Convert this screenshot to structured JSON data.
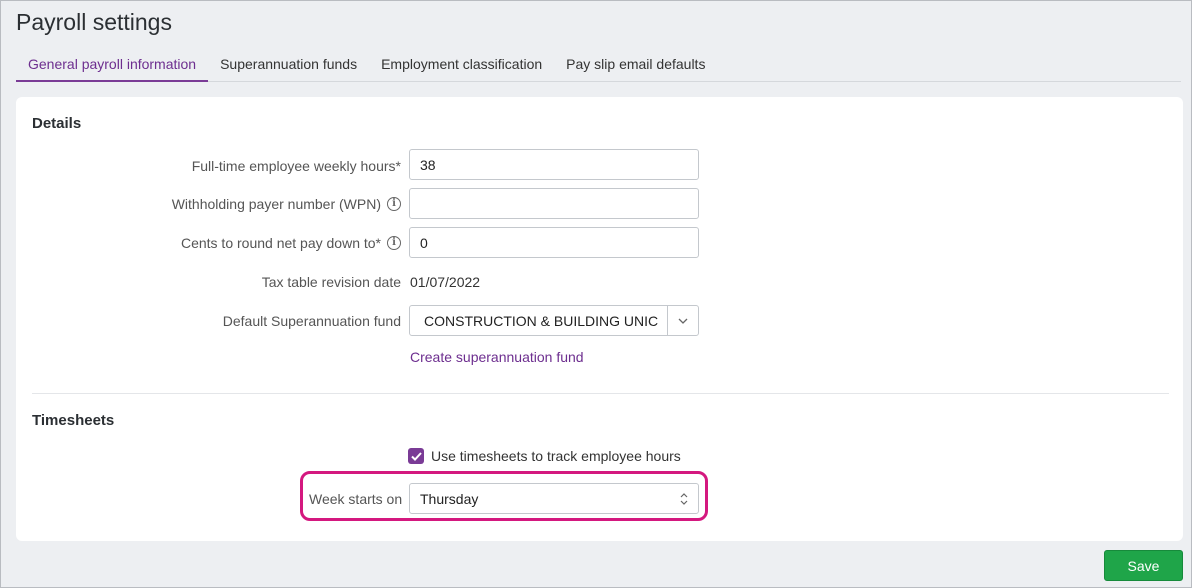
{
  "page": {
    "title": "Payroll settings"
  },
  "tabs": [
    {
      "label": "General payroll information",
      "active": true
    },
    {
      "label": "Superannuation funds",
      "active": false
    },
    {
      "label": "Employment classification",
      "active": false
    },
    {
      "label": "Pay slip email defaults",
      "active": false
    }
  ],
  "details": {
    "heading": "Details",
    "weekly_hours": {
      "label": "Full-time employee weekly hours*",
      "value": "38"
    },
    "wpn": {
      "label": "Withholding payer number (WPN)",
      "value": "",
      "info_icon": "info-icon"
    },
    "rounding": {
      "label": "Cents to round net pay down to*",
      "value": "0",
      "info_icon": "info-icon"
    },
    "tax_table": {
      "label": "Tax table revision date",
      "value": "01/07/2022"
    },
    "super_fund": {
      "label": "Default Superannuation fund",
      "value": "CONSTRUCTION & BUILDING UNIC"
    },
    "create_link": "Create superannuation fund"
  },
  "timesheets": {
    "heading": "Timesheets",
    "use_timesheets": {
      "label": "Use timesheets to track employee hours",
      "checked": true
    },
    "week_starts": {
      "label": "Week starts on",
      "value": "Thursday"
    }
  },
  "actions": {
    "save_label": "Save"
  },
  "colors": {
    "accent": "#7a3b96",
    "highlight": "#d4187f",
    "save": "#1fa549"
  }
}
